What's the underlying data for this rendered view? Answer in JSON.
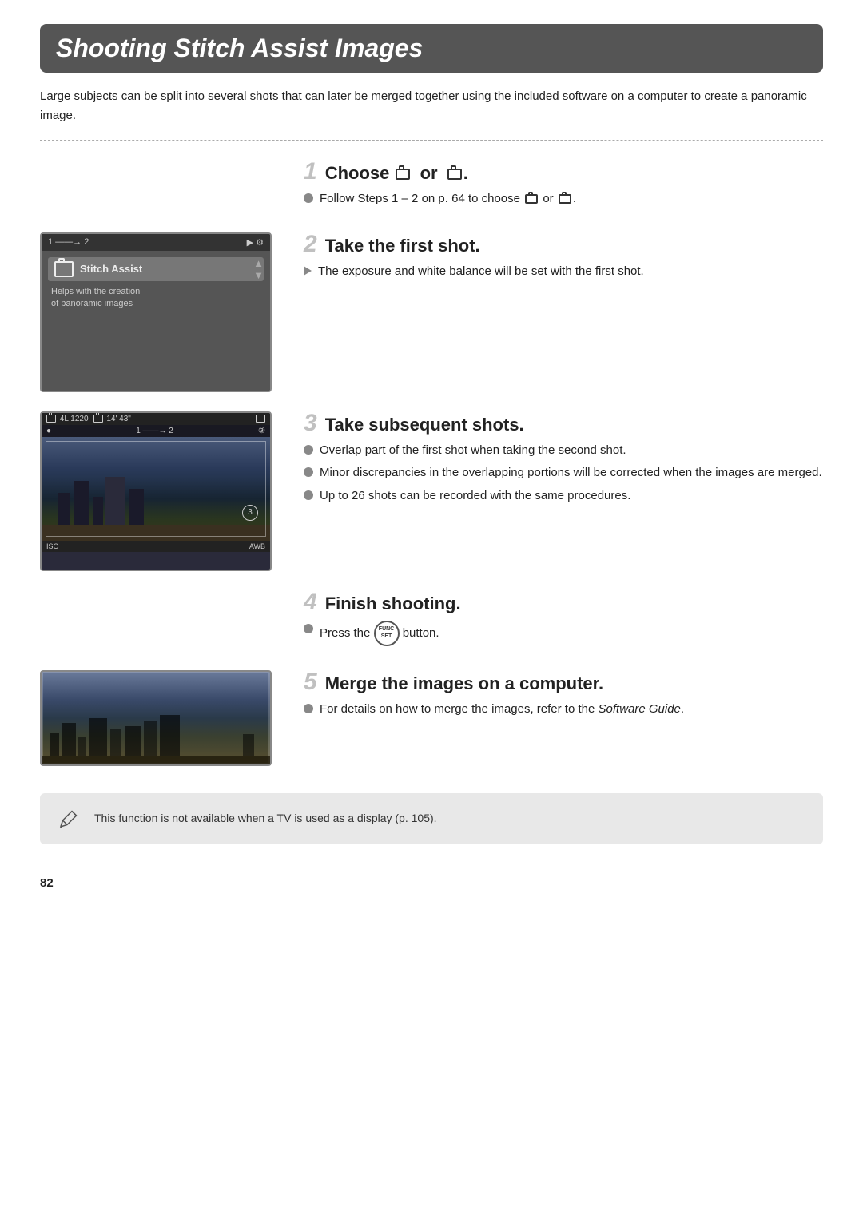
{
  "page": {
    "title": "Shooting Stitch Assist Images",
    "intro": "Large subjects can be split into several shots that can later be merged together using the included software on a computer to create a panoramic image.",
    "page_number": "82"
  },
  "steps": [
    {
      "number": "1",
      "heading": "Choose",
      "heading_suffix": "or",
      "has_image": false,
      "bullets": [
        {
          "type": "circle",
          "text": "Follow Steps 1 – 2 on p. 64 to choose  or ."
        }
      ]
    },
    {
      "number": "2",
      "heading": "Take the first shot.",
      "has_image": true,
      "image_type": "menu",
      "bullets": [
        {
          "type": "triangle",
          "text": "The exposure and white balance will be set with the first shot."
        }
      ]
    },
    {
      "number": "3",
      "heading": "Take subsequent shots.",
      "has_image": true,
      "image_type": "landscape",
      "bullets": [
        {
          "type": "circle",
          "text": "Overlap part of the first shot when taking the second shot."
        },
        {
          "type": "circle",
          "text": "Minor discrepancies in the overlapping portions will be corrected when the images are merged."
        },
        {
          "type": "circle",
          "text": "Up to 26 shots can be recorded with the same procedures."
        }
      ]
    },
    {
      "number": "4",
      "heading": "Finish shooting.",
      "has_image": false,
      "bullets": [
        {
          "type": "circle",
          "text": "Press the  button."
        }
      ]
    },
    {
      "number": "5",
      "heading": "Merge the images on a computer.",
      "has_image": true,
      "image_type": "panoramic",
      "bullets": [
        {
          "type": "circle",
          "text": "For details on how to merge the images, refer to the Software Guide."
        }
      ]
    }
  ],
  "note": {
    "text": "This function is not available when a TV is used as a display (p. 105)."
  },
  "icons": {
    "stitch_left": "⊡",
    "stitch_right": "⊟",
    "func_set_label": "FUNC\nSET",
    "pencil": "✏"
  },
  "camera_menu": {
    "top_bar_left": "1  ——→  2",
    "item_label": "Stitch Assist",
    "item_desc1": "Helps with the creation",
    "item_desc2": "of panoramic images"
  },
  "camera_landscape": {
    "status_left": "⊡ 4L 1220",
    "status_mid": "14'43\"",
    "status_right": "⊡",
    "row2_left": "â",
    "row2_mid": "1  ——→  2",
    "row2_right": "③"
  }
}
